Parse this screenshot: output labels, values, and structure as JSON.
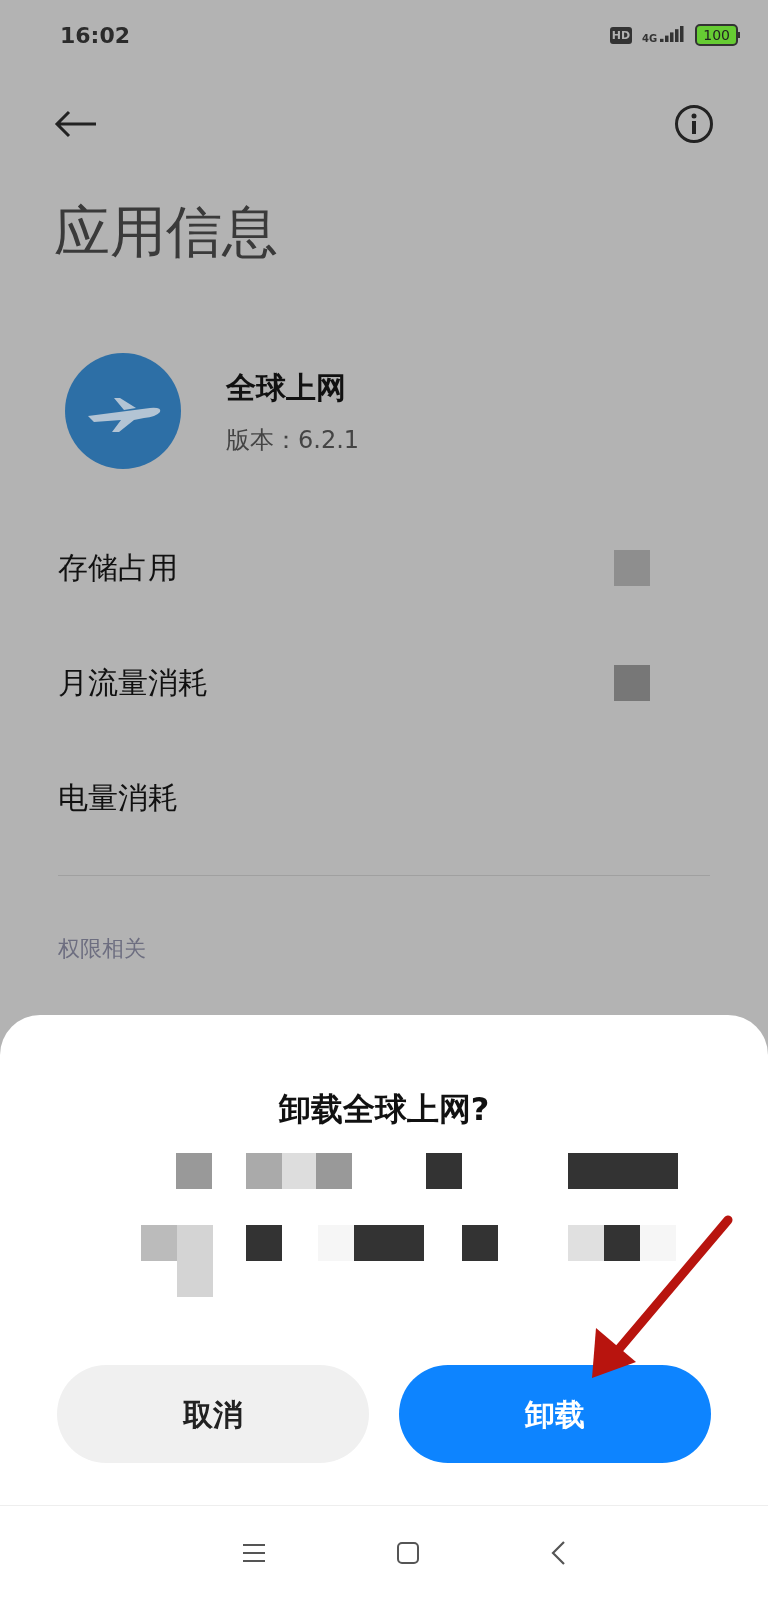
{
  "status_bar": {
    "time": "16:02",
    "hd": "HD",
    "network": "4G",
    "battery": "100"
  },
  "page": {
    "title": "应用信息"
  },
  "app": {
    "name": "全球上网",
    "version": "版本：6.2.1"
  },
  "rows": [
    {
      "label": "存储占用"
    },
    {
      "label": "月流量消耗"
    },
    {
      "label": "电量消耗"
    }
  ],
  "section": "权限相关",
  "dialog": {
    "title": "卸载全球上网?",
    "buttons": [
      {
        "label": "取消",
        "kind": "secondary"
      },
      {
        "label": "卸载",
        "kind": "primary"
      }
    ]
  }
}
